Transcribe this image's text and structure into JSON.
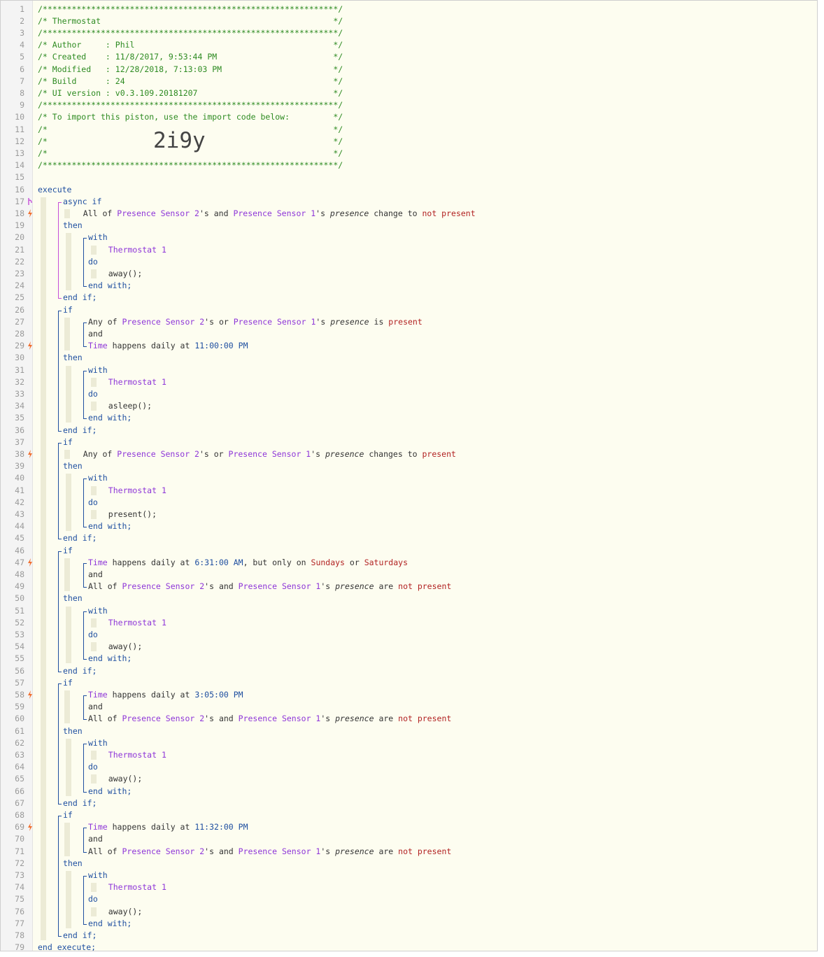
{
  "header": {
    "stars": "/*************************************************************/",
    "title": "/* Thermostat                                                */",
    "author": "/* Author     : Phil                                         */",
    "created": "/* Created    : 11/8/2017, 9:53:44 PM                        */",
    "modified": "/* Modified   : 12/28/2018, 7:13:03 PM                       */",
    "build": "/* Build      : 24                                           */",
    "ui_version": "/* UI version : v0.3.109.20181207                            */",
    "import_note": "/* To import this piston, use the import code below:         */",
    "blank": "/*                                                           */",
    "import_code": "2i9y"
  },
  "kw": {
    "execute": "execute",
    "end_execute": "end execute;",
    "async_if": "async if",
    "if": "if",
    "then": "then",
    "with": "with",
    "do": "do",
    "end_with": "end with;",
    "end_if": "end if;",
    "and": "and"
  },
  "devices": {
    "ps2": "Presence Sensor 2",
    "ps1": "Presence Sensor 1",
    "thermostat": "Thermostat 1",
    "time": "Time"
  },
  "text": {
    "all_of": "All of ",
    "any_of": "Any of ",
    "s_and": "'s and ",
    "s_or": "'s or ",
    "s": "'s ",
    "presence": "presence",
    "change_to": " change to ",
    "changes_to": " changes to ",
    "is": " is ",
    "are": " are ",
    "happens_daily_at": " happens daily at ",
    "but_only_on": ", but only on ",
    "or": " or "
  },
  "values": {
    "not_present": "not present",
    "present": "present",
    "t_2300": "11:00:00 PM",
    "t_0631": "6:31:00 AM",
    "t_1505": "3:05:00 PM",
    "t_2332": "11:32:00 PM",
    "sundays": "Sundays",
    "saturdays": "Saturdays"
  },
  "actions": {
    "away": "away();",
    "asleep": "asleep();",
    "present": "present();"
  },
  "colors": {
    "comment": "#2e8b22",
    "keyword": "#1f4fa0",
    "device": "#8e36d8",
    "value": "#b22222",
    "marker": "#f07030"
  }
}
